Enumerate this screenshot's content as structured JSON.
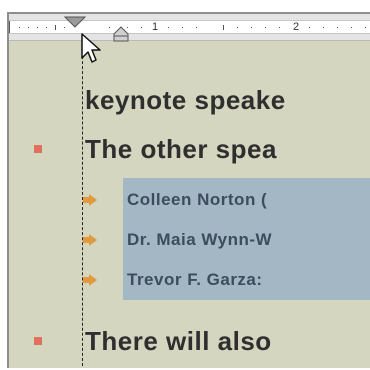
{
  "ruler": {
    "numbers": [
      "1",
      "2"
    ],
    "first_line_indent_icon": "first-line-indent-triangle",
    "hanging_indent_icon": "hanging-indent-marker"
  },
  "slide": {
    "line_keynote": "keynote speake",
    "bullet_other": "The other spea",
    "sub_colleen": "Colleen Norton (",
    "sub_maia": "Dr. Maia Wynn-W",
    "sub_trevor": "Trevor F. Garza:",
    "bullet_there": "There will also"
  },
  "colors": {
    "slide_background": "#d4d6c0",
    "highlight": "#a3b7c4",
    "level1_bullet": "#e07060",
    "level2_bullet": "#e09a40",
    "level2_text": "#3c4d5e"
  },
  "icons": {
    "pointer": "mouse-pointer-icon"
  }
}
